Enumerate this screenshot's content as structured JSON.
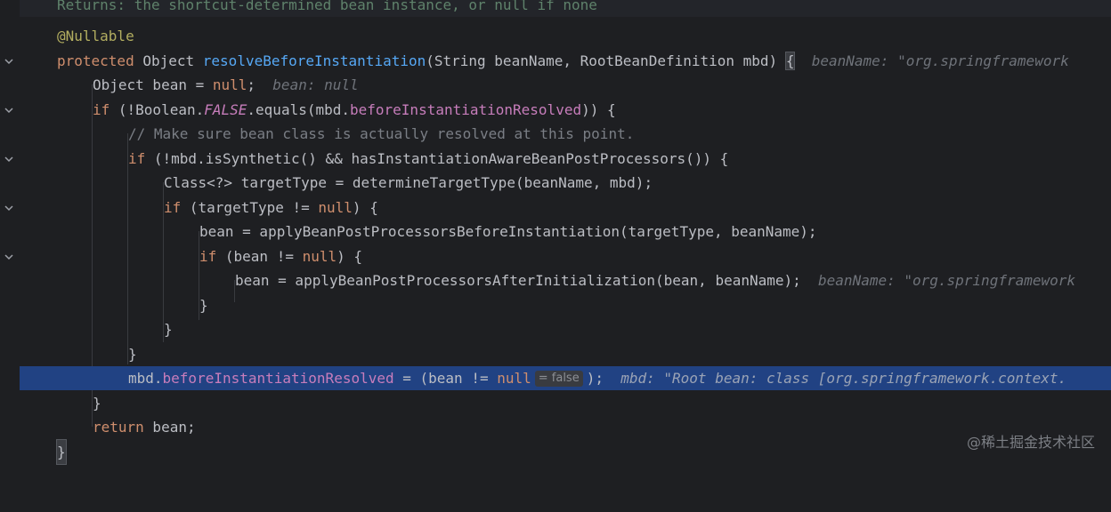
{
  "editor": {
    "doc_line": "Returns: the shortcut-determined bean instance, or null if none",
    "lines": {
      "l1": "@Nullable",
      "l2_kw": "protected",
      "l2_type": "Object",
      "l2_method": "resolveBeforeInstantiation",
      "l2_params": "(String beanName, RootBeanDefinition mbd)",
      "l2_brace": "{",
      "l2_hint": "beanName: \"org.springframework",
      "l3_code": "Object bean = ",
      "l3_null": "null",
      "l3_semi": ";",
      "l3_hint": "bean: null",
      "l4_if": "if",
      "l4_a": " (!Boolean.",
      "l4_false": "FALSE",
      "l4_b": ".equals(mbd.",
      "l4_field": "beforeInstantiationResolved",
      "l4_c": ")) {",
      "l5_comment": "// Make sure bean class is actually resolved at this point.",
      "l6_if": "if",
      "l6_rest": " (!mbd.isSynthetic() && hasInstantiationAwareBeanPostProcessors()) {",
      "l7": "Class<?> targetType = determineTargetType(beanName, mbd);",
      "l8_if": "if",
      "l8_a": " (targetType != ",
      "l8_null": "null",
      "l8_b": ") {",
      "l9": "bean = applyBeanPostProcessorsBeforeInstantiation(targetType, beanName);",
      "l10_if": "if",
      "l10_a": " (bean != ",
      "l10_null": "null",
      "l10_b": ") {",
      "l11": "bean = applyBeanPostProcessorsAfterInitialization(bean, beanName);",
      "l11_hint": "beanName: \"org.springframework",
      "l12": "}",
      "l13": "}",
      "l14": "}",
      "l15_a": "mbd.",
      "l15_field": "beforeInstantiationResolved",
      "l15_b": " = (bean != ",
      "l15_null": "null",
      "l15_inlay": "= false",
      "l15_c": ");",
      "l15_hint": "mbd: \"Root bean: class [org.springframework.context.",
      "l16": "}",
      "l17_kw": "return",
      "l17_rest": " bean;",
      "l18": "}"
    },
    "watermark": "@稀土掘金技术社区",
    "colors": {
      "background": "#1e1f22",
      "current_line": "#214283",
      "keyword": "#cf8e6d",
      "method": "#56a8f5",
      "field": "#c77dbb",
      "comment": "#7a7e85",
      "annotation": "#b3ae60"
    }
  }
}
